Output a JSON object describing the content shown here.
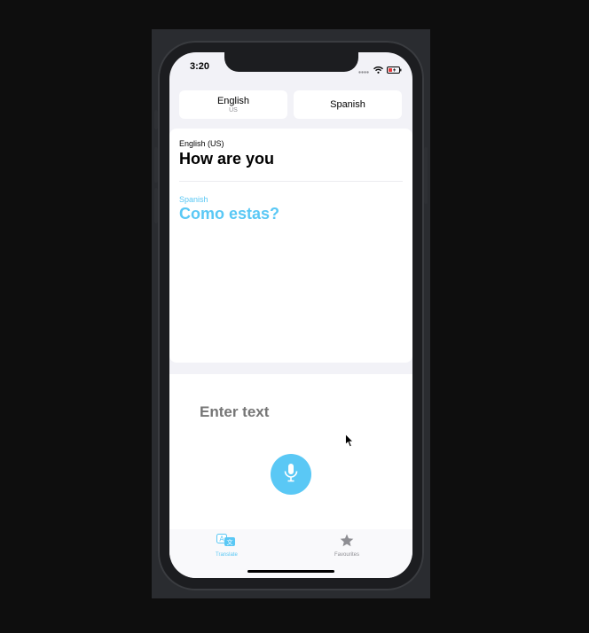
{
  "status_bar": {
    "time": "3:20"
  },
  "language_selector": {
    "source": {
      "label": "English",
      "variant": "US"
    },
    "target": {
      "label": "Spanish"
    }
  },
  "translation": {
    "source_language": "English (US)",
    "source_text": "How are you",
    "target_language": "Spanish",
    "target_text": "Como estas?"
  },
  "input": {
    "placeholder": "Enter text"
  },
  "tabs": [
    {
      "label": "Translate",
      "icon": "translate-icon",
      "active": true
    },
    {
      "label": "Favourites",
      "icon": "star-icon",
      "active": false
    }
  ],
  "colors": {
    "accent": "#5ac8f5",
    "inactive": "#8e8e93",
    "background": "#f2f2f7"
  }
}
